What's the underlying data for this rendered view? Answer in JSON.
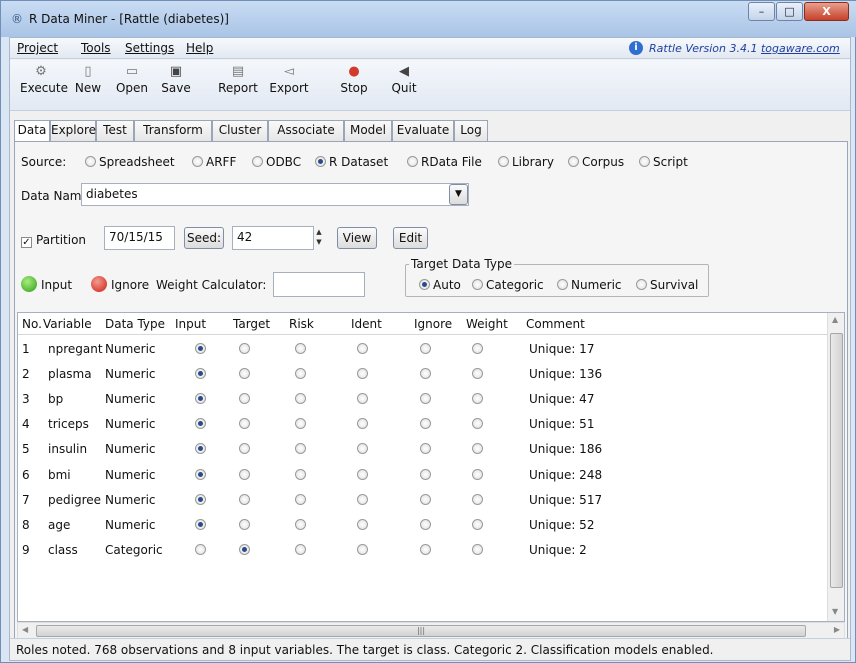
{
  "window": {
    "title": "R Data Miner - [Rattle (diabetes)]",
    "minimize": "–",
    "maximize": "□",
    "close": "X"
  },
  "menus": [
    "Project",
    "Tools",
    "Settings",
    "Help"
  ],
  "version": {
    "text": "Rattle Version 3.4.1",
    "link": "togaware.com"
  },
  "toolbar": [
    "Execute",
    "New",
    "Open",
    "Save",
    "Report",
    "Export",
    "Stop",
    "Quit"
  ],
  "tabs": [
    "Data",
    "Explore",
    "Test",
    "Transform",
    "Cluster",
    "Associate",
    "Model",
    "Evaluate",
    "Log"
  ],
  "source": {
    "label": "Source:",
    "options": [
      "Spreadsheet",
      "ARFF",
      "ODBC",
      "R Dataset",
      "RData File",
      "Library",
      "Corpus",
      "Script"
    ],
    "selected": "R Dataset"
  },
  "data_name": {
    "label": "Data Name:",
    "value": "diabetes"
  },
  "partition": {
    "label": "Partition",
    "checked": true,
    "value": "70/15/15",
    "seed_label": "Seed:",
    "seed": "42",
    "view": "View",
    "edit": "Edit"
  },
  "roles": {
    "input": "Input",
    "ignore": "Ignore",
    "weight_label": "Weight Calculator:"
  },
  "target_type": {
    "label": "Target Data Type",
    "options": [
      "Auto",
      "Categoric",
      "Numeric",
      "Survival"
    ],
    "selected": "Auto"
  },
  "table": {
    "headers": [
      "No.",
      "Variable",
      "Data Type",
      "Input",
      "Target",
      "Risk",
      "Ident",
      "Ignore",
      "Weight",
      "Comment"
    ],
    "rows": [
      {
        "no": "1",
        "variable": "npregant",
        "type": "Numeric",
        "role": "Input",
        "comment": "Unique: 17"
      },
      {
        "no": "2",
        "variable": "plasma",
        "type": "Numeric",
        "role": "Input",
        "comment": "Unique: 136"
      },
      {
        "no": "3",
        "variable": "bp",
        "type": "Numeric",
        "role": "Input",
        "comment": "Unique: 47"
      },
      {
        "no": "4",
        "variable": "triceps",
        "type": "Numeric",
        "role": "Input",
        "comment": "Unique: 51"
      },
      {
        "no": "5",
        "variable": "insulin",
        "type": "Numeric",
        "role": "Input",
        "comment": "Unique: 186"
      },
      {
        "no": "6",
        "variable": "bmi",
        "type": "Numeric",
        "role": "Input",
        "comment": "Unique: 248"
      },
      {
        "no": "7",
        "variable": "pedigree",
        "type": "Numeric",
        "role": "Input",
        "comment": "Unique: 517"
      },
      {
        "no": "8",
        "variable": "age",
        "type": "Numeric",
        "role": "Input",
        "comment": "Unique: 52"
      },
      {
        "no": "9",
        "variable": "class",
        "type": "Categoric",
        "role": "Target",
        "comment": "Unique: 2"
      }
    ]
  },
  "status": "Roles noted. 768 observations and 8 input variables. The target is class. Categoric 2. Classification models enabled."
}
